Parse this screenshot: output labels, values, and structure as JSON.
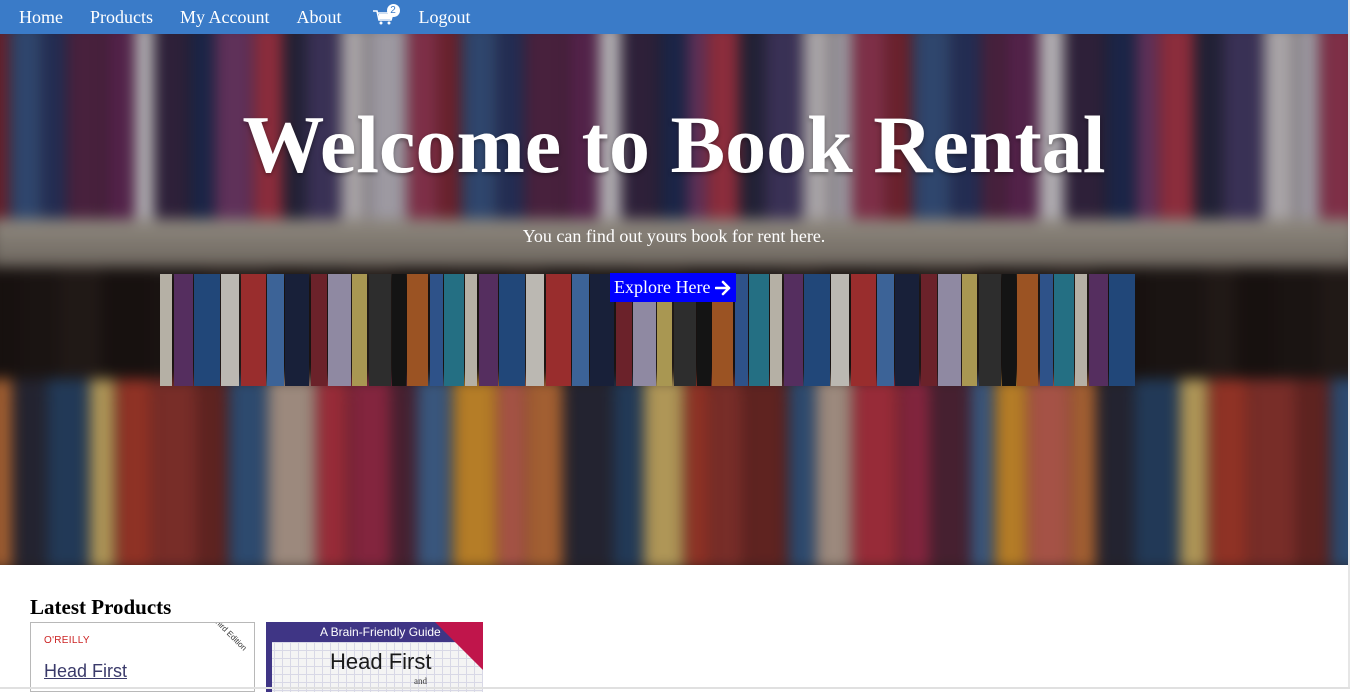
{
  "nav": {
    "home": "Home",
    "products": "Products",
    "account": "My Account",
    "about": "About",
    "cart_icon": "cart-icon",
    "cart_count": "2",
    "logout": "Logout",
    "bar_color": "#3a7bc8"
  },
  "hero": {
    "title": "Welcome to Book Rental",
    "subtitle": "You can find out yours book for rent here.",
    "button_label": "Explore Here",
    "button_icon": "arrow-right-icon",
    "button_color": "#0000ff"
  },
  "latest": {
    "heading": "Latest Products",
    "products": [
      {
        "publisher": "O'REILLY",
        "title": "Head First",
        "ribbon": "Third Edition"
      },
      {
        "header": "A Brain-Friendly Guide",
        "title": "Head First",
        "sub": "and"
      }
    ]
  }
}
